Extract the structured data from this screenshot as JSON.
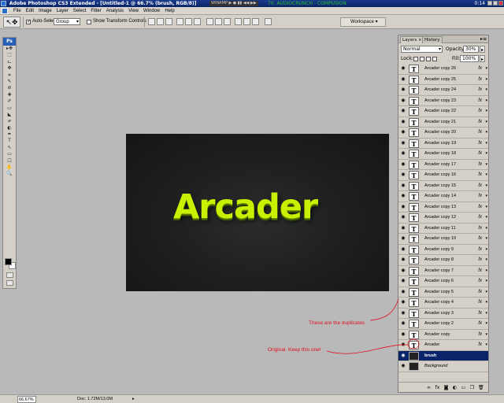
{
  "titlebar": {
    "title": "Adobe Photoshop CS3 Extended - [Untitled-1 @ 66.7% (brush, RGB/8)]",
    "winamp": "WINAMP ▶ ◼ ▮▮ ◀◀ ▶▶",
    "now_playing": "70. AUDIOCRUNCH - COMPUSION",
    "clock": "0:14"
  },
  "menubar": {
    "items": [
      "File",
      "Edit",
      "Image",
      "Layer",
      "Select",
      "Filter",
      "Analysis",
      "View",
      "Window",
      "Help"
    ]
  },
  "options": {
    "auto_select_label": "Auto-Select:",
    "auto_select_value": "Group",
    "transform_label": "Show Transform Controls",
    "workspace_label": "Workspace ▾"
  },
  "toolbox": {
    "logo": "Ps",
    "tools": [
      "▸✥",
      "⬚",
      "ᓚ",
      "✥",
      "⌗",
      "✎",
      "⊘",
      "✚",
      "✐",
      "▭",
      "◣",
      "⌀",
      "◐",
      "✒",
      "T",
      "↖",
      "▭",
      "☐",
      "✋",
      "🔍"
    ]
  },
  "canvas": {
    "text": "Arcader"
  },
  "layers_panel": {
    "tab_layers": "Layers ×",
    "tab_history": "History",
    "blend_mode": "Normal",
    "opacity_label": "Opacity:",
    "opacity_value": "30%",
    "lock_label": "Lock:",
    "fill_label": "Fill:",
    "fill_value": "100%",
    "layers": [
      {
        "name": "Arcader copy 26",
        "type": "text"
      },
      {
        "name": "Arcader copy 25",
        "type": "text"
      },
      {
        "name": "Arcader copy 24",
        "type": "text"
      },
      {
        "name": "Arcader copy 23",
        "type": "text"
      },
      {
        "name": "Arcader copy 22",
        "type": "text"
      },
      {
        "name": "Arcader copy 21",
        "type": "text"
      },
      {
        "name": "Arcader copy 20",
        "type": "text"
      },
      {
        "name": "Arcader copy 19",
        "type": "text"
      },
      {
        "name": "Arcader copy 18",
        "type": "text"
      },
      {
        "name": "Arcader copy 17",
        "type": "text"
      },
      {
        "name": "Arcader copy 16",
        "type": "text"
      },
      {
        "name": "Arcader copy 15",
        "type": "text"
      },
      {
        "name": "Arcader copy 14",
        "type": "text"
      },
      {
        "name": "Arcader copy 13",
        "type": "text"
      },
      {
        "name": "Arcader copy 12",
        "type": "text"
      },
      {
        "name": "Arcader copy 11",
        "type": "text"
      },
      {
        "name": "Arcader copy 10",
        "type": "text"
      },
      {
        "name": "Arcader copy 9",
        "type": "text"
      },
      {
        "name": "Arcader copy 8",
        "type": "text"
      },
      {
        "name": "Arcader copy 7",
        "type": "text"
      },
      {
        "name": "Arcader copy 6",
        "type": "text"
      },
      {
        "name": "Arcader copy 5",
        "type": "text"
      },
      {
        "name": "Arcader copy 4",
        "type": "text"
      },
      {
        "name": "Arcader copy 3",
        "type": "text"
      },
      {
        "name": "Arcader copy 2",
        "type": "text"
      },
      {
        "name": "Arcader copy",
        "type": "text"
      },
      {
        "name": "Arcader",
        "type": "text"
      },
      {
        "name": "brush",
        "type": "image",
        "selected": true
      },
      {
        "name": "Background",
        "type": "image"
      }
    ],
    "fx_label": "fx",
    "text_thumb": "T"
  },
  "status": {
    "zoom": "66.67%",
    "doc": "Doc: 1.72M/13.0M"
  },
  "annotations": {
    "duplicates": "These are the duplicates",
    "original": "Original. Keep this one!"
  },
  "colors": {
    "accent_text": "#c8f000",
    "annotation": "#e0101e",
    "selection": "#0a246a"
  }
}
